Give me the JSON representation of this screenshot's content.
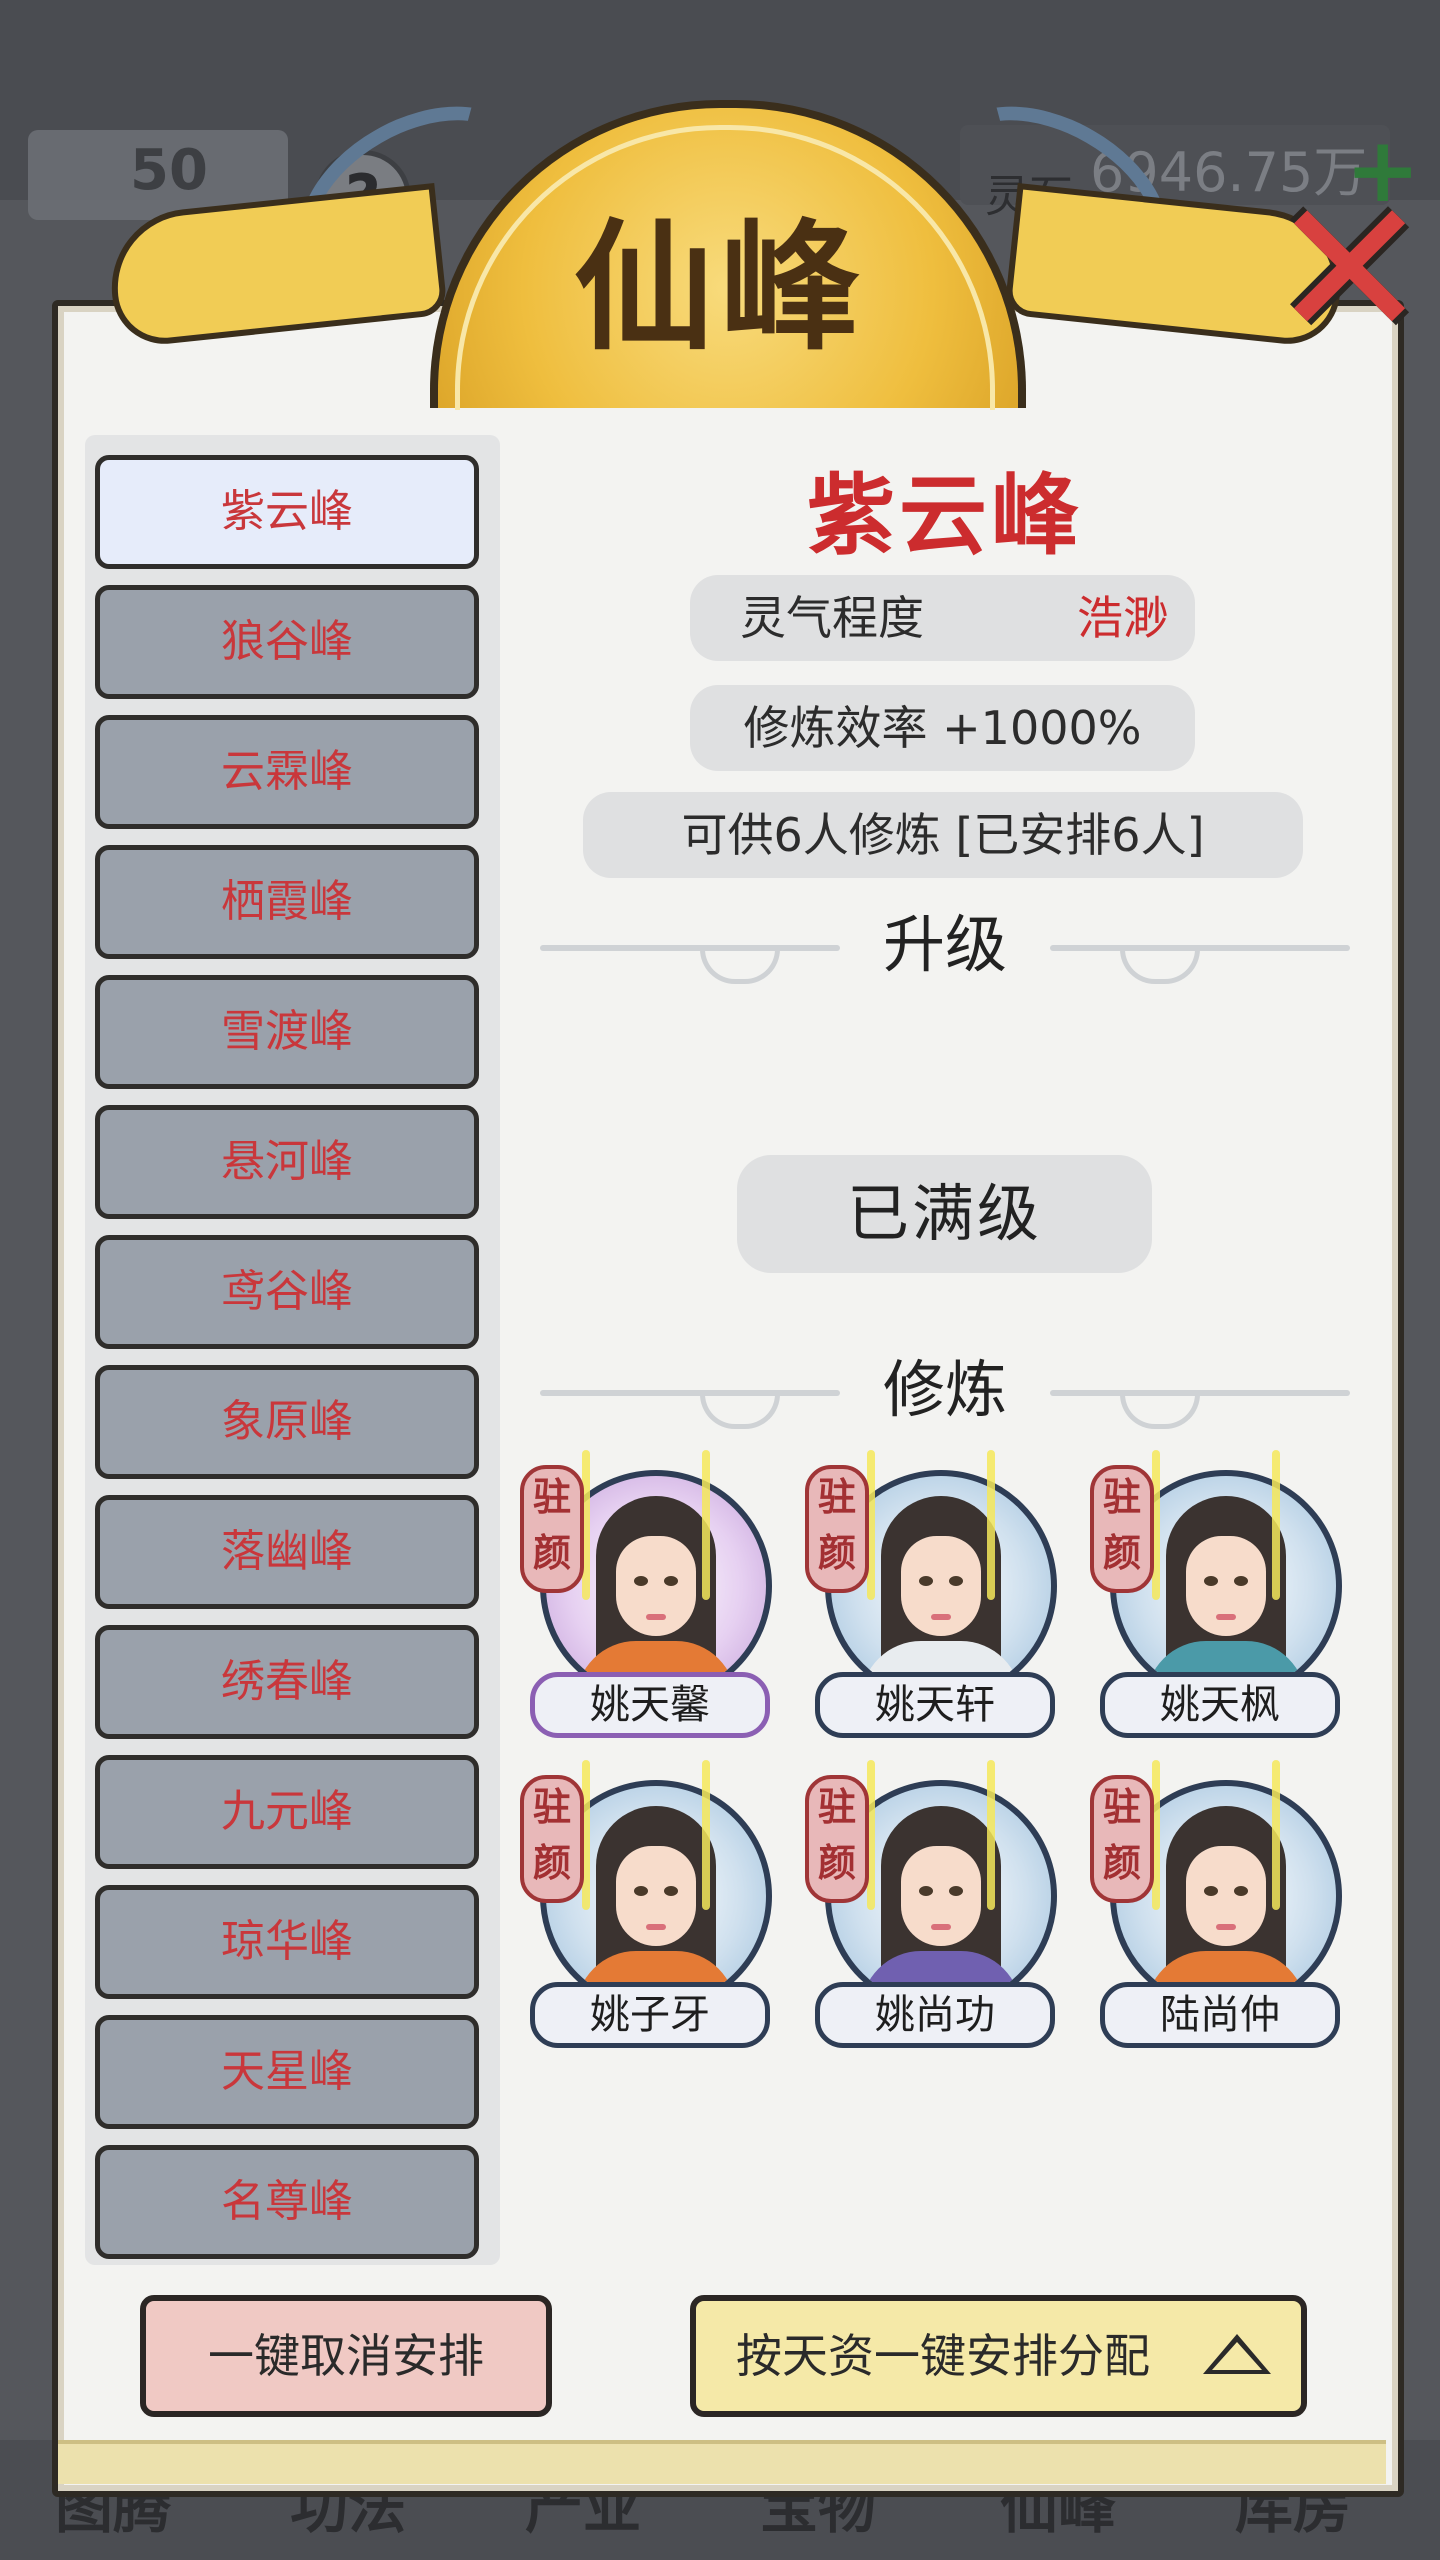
{
  "hud": {
    "level": "50",
    "help_symbol": "?",
    "spirit_stone_label": "灵石",
    "spirit_stone_value": "6946.75万",
    "plus_symbol": "+"
  },
  "dialog": {
    "title": "仙峰",
    "close_symbol": "✕"
  },
  "peaks": [
    {
      "label": "紫云峰",
      "selected": true
    },
    {
      "label": "狼谷峰",
      "selected": false
    },
    {
      "label": "云霖峰",
      "selected": false
    },
    {
      "label": "栖霞峰",
      "selected": false
    },
    {
      "label": "雪渡峰",
      "selected": false
    },
    {
      "label": "悬河峰",
      "selected": false
    },
    {
      "label": "鸢谷峰",
      "selected": false
    },
    {
      "label": "象原峰",
      "selected": false
    },
    {
      "label": "落幽峰",
      "selected": false
    },
    {
      "label": "绣春峰",
      "selected": false
    },
    {
      "label": "九元峰",
      "selected": false
    },
    {
      "label": "琼华峰",
      "selected": false
    },
    {
      "label": "天星峰",
      "selected": false
    },
    {
      "label": "名尊峰",
      "selected": false
    }
  ],
  "detail": {
    "peak_name": "紫云峰",
    "aura_label": "灵气程度",
    "aura_value": "浩渺",
    "efficiency": "修炼效率 +1000%",
    "capacity": "可供6人修炼 [已安排6人]",
    "upgrade_title": "升级",
    "max_level_label": "已满级",
    "cultivate_title": "修炼"
  },
  "disciples": [
    {
      "tag": "驻颜",
      "name": "姚天馨",
      "frame": "purple",
      "robe": "orange"
    },
    {
      "tag": "驻颜",
      "name": "姚天轩",
      "frame": "blue",
      "robe": "white"
    },
    {
      "tag": "驻颜",
      "name": "姚天枫",
      "frame": "blue",
      "robe": "blue"
    },
    {
      "tag": "驻颜",
      "name": "姚子牙",
      "frame": "blue",
      "robe": "orange"
    },
    {
      "tag": "驻颜",
      "name": "姚尚功",
      "frame": "blue",
      "robe": "purple"
    },
    {
      "tag": "驻颜",
      "name": "陆尚仲",
      "frame": "blue",
      "robe": "orange"
    }
  ],
  "actions": {
    "cancel_all": "一键取消安排",
    "auto_arrange": "按天资一键安排分配"
  },
  "bottom_nav": [
    "图腾",
    "功法",
    "产业",
    "宝物",
    "仙峰",
    "库房"
  ],
  "colors": {
    "accent_red": "#cc2c2e",
    "gold": "#efbe3e",
    "list_button": "#9aa1ab",
    "selected_button": "#e6ecfa"
  }
}
